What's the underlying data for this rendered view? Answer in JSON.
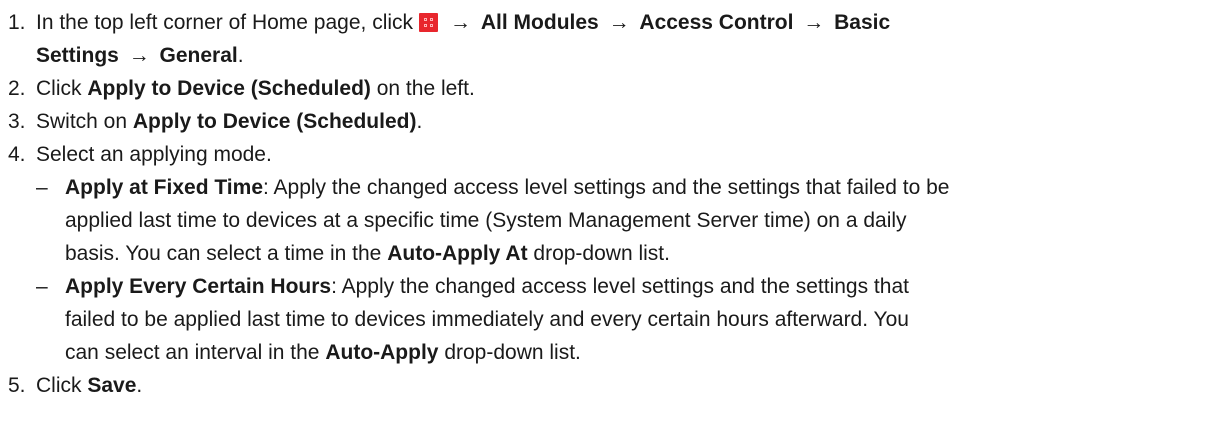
{
  "steps": [
    {
      "num": "1.",
      "pre": "In the top left corner of Home page, click",
      "icon": "all-modules-grid-icon",
      "icon_color": "#e8262d",
      "arrow": "→",
      "path": [
        "All Modules",
        "Access Control",
        "Basic",
        "Settings",
        "General"
      ],
      "end": "."
    },
    {
      "num": "2.",
      "pre": "Click ",
      "bold": "Apply to Device (Scheduled)",
      "post": " on the left."
    },
    {
      "num": "3.",
      "pre": "Switch on ",
      "bold": "Apply to Device (Scheduled)",
      "post": "."
    },
    {
      "num": "4.",
      "text": "Select an applying mode.",
      "bullets": [
        {
          "dash": "–",
          "term": "Apply at Fixed Time",
          "lines": [
            ": Apply the changed access level settings and the settings that failed to be",
            "applied last time to devices at a specific time (System Management Server time) on a daily",
            "basis. You can select a time in the "
          ],
          "bold_end": "Auto-Apply At",
          "end": " drop-down list."
        },
        {
          "dash": "–",
          "term": "Apply Every Certain Hours",
          "lines": [
            ": Apply the changed access level settings and the settings that",
            "failed to be applied last time to devices immediately and every certain hours afterward. You",
            "can select an interval in the "
          ],
          "bold_end": "Auto-Apply",
          "end": " drop-down list."
        }
      ]
    },
    {
      "num": "5.",
      "pre": "Click ",
      "bold": "Save",
      "post": "."
    }
  ]
}
